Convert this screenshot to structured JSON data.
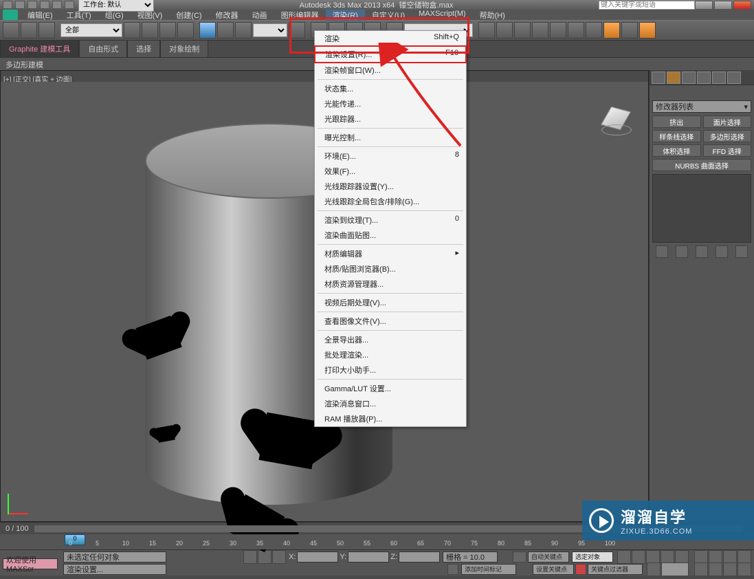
{
  "title": {
    "app": "Autodesk 3ds Max 2013 x64",
    "file": "镂空储物盒.max",
    "workbench_label": "工作台: 默认",
    "search_placeholder": "键入关键字或短语"
  },
  "menus": [
    "编辑(E)",
    "工具(T)",
    "组(G)",
    "视图(V)",
    "创建(C)",
    "修改器",
    "动画",
    "图形编辑器",
    "渲染(R)",
    "自定义(U)",
    "MAXScript(M)",
    "帮助(H)"
  ],
  "active_menu_index": 8,
  "toolbar_select": "全部",
  "tabs_row": {
    "graphite": "Graphite 建模工具",
    "freeform": "自由形式",
    "select": "选择",
    "paint": "对象绘制",
    "poly": "多边形建模"
  },
  "viewport_label": "[+] [正交] [真实 + 边面]",
  "dropdown": {
    "groups": [
      [
        {
          "label": "渲染",
          "shortcut": "Shift+Q"
        },
        {
          "label": "渲染设置(R)...",
          "shortcut": "F10",
          "highlight": true
        },
        {
          "label": "渲染帧窗口(W)...",
          "shortcut": ""
        }
      ],
      [
        {
          "label": "状态集...",
          "shortcut": ""
        },
        {
          "label": "光能传递...",
          "shortcut": ""
        },
        {
          "label": "光跟踪器...",
          "shortcut": ""
        }
      ],
      [
        {
          "label": "曝光控制...",
          "shortcut": ""
        }
      ],
      [
        {
          "label": "环境(E)...",
          "shortcut": "8"
        },
        {
          "label": "效果(F)...",
          "shortcut": ""
        },
        {
          "label": "光线跟踪器设置(Y)...",
          "shortcut": ""
        },
        {
          "label": "光线跟踪全局包含/排除(G)...",
          "shortcut": ""
        }
      ],
      [
        {
          "label": "渲染到纹理(T)...",
          "shortcut": "0"
        },
        {
          "label": "渲染曲面贴图...",
          "shortcut": ""
        }
      ],
      [
        {
          "label": "材质编辑器",
          "shortcut": "▸"
        },
        {
          "label": "材质/贴图浏览器(B)...",
          "shortcut": ""
        },
        {
          "label": "材质资源管理器...",
          "shortcut": ""
        }
      ],
      [
        {
          "label": "视频后期处理(V)...",
          "shortcut": ""
        }
      ],
      [
        {
          "label": "查看图像文件(V)...",
          "shortcut": ""
        }
      ],
      [
        {
          "label": "全景导出器...",
          "shortcut": ""
        },
        {
          "label": "批处理渲染...",
          "shortcut": ""
        },
        {
          "label": "打印大小助手...",
          "shortcut": ""
        }
      ],
      [
        {
          "label": "Gamma/LUT 设置...",
          "shortcut": ""
        },
        {
          "label": "渲染消息窗口...",
          "shortcut": ""
        },
        {
          "label": "RAM 播放器(P)...",
          "shortcut": ""
        }
      ]
    ]
  },
  "right_panel": {
    "combo": "修改器列表",
    "buttons": [
      "挤出",
      "面片选择",
      "样条线选择",
      "多边形选择",
      "体积选择",
      "FFD 选择"
    ],
    "nurbs": "NURBS 曲面选择"
  },
  "timeline": {
    "current": "0",
    "total": "100",
    "ticks": [
      "0",
      "5",
      "10",
      "15",
      "20",
      "25",
      "30",
      "35",
      "40",
      "45",
      "50",
      "55",
      "60",
      "65",
      "70",
      "75",
      "80",
      "85",
      "90",
      "95",
      "100"
    ]
  },
  "status": {
    "welcome": "欢迎使用 MAXScr",
    "no_select": "未选定任何对象",
    "render_set": "渲染设置...",
    "x": "X:",
    "y": "Y:",
    "z": "Z:",
    "grid": "栅格 = 10.0",
    "add_timemark": "添加时间标记",
    "auto_key": "自动关键点",
    "sel_obj": "选定对象",
    "set_key": "设置关键点",
    "key_filter": "关键点过滤器"
  },
  "watermark": {
    "main": "溜溜自学",
    "sub": "ZIXUE.3D66.COM"
  }
}
